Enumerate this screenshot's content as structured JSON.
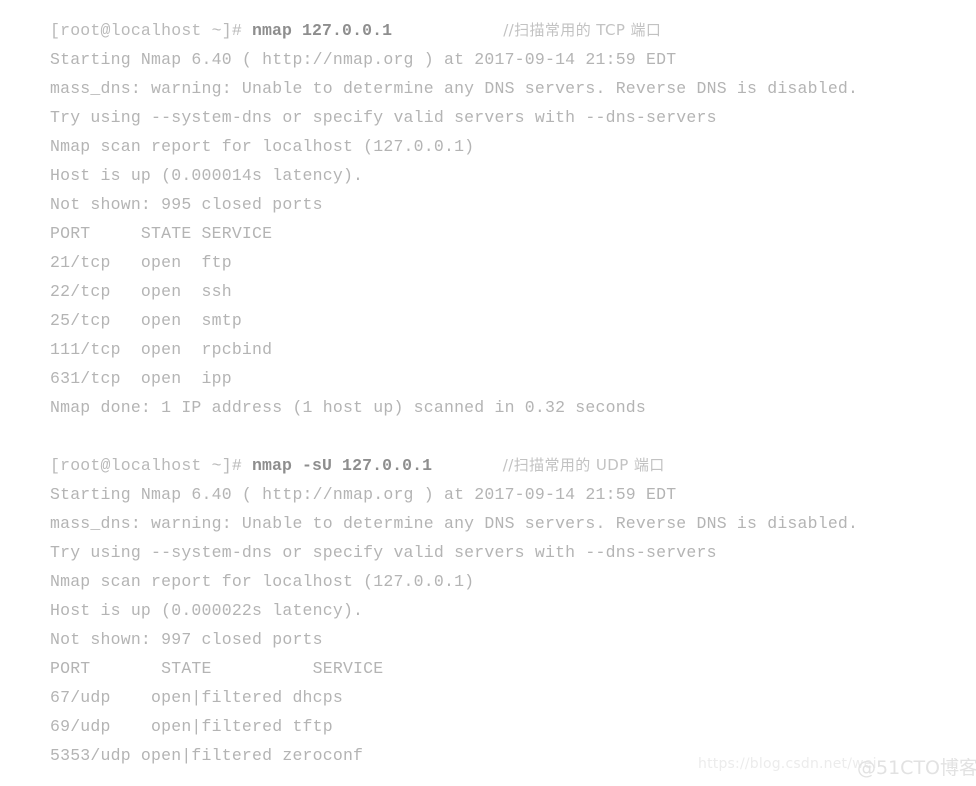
{
  "terminal": {
    "font_color": "#b4b4b4",
    "command_color": "#8e8e8e",
    "background": "#ffffff",
    "blocks": [
      {
        "name": "tcp-scan",
        "prompt": "[root@localhost ~]# ",
        "command": "nmap 127.0.0.1",
        "comment": "//扫描常用的 TCP 端口",
        "comment_ascii": "TCP",
        "output": [
          "Starting Nmap 6.40 ( http://nmap.org ) at 2017-09-14 21:59 EDT",
          "mass_dns: warning: Unable to determine any DNS servers. Reverse DNS is disabled.",
          "Try using --system-dns or specify valid servers with --dns-servers",
          "Nmap scan report for localhost (127.0.0.1)",
          "Host is up (0.000014s latency).",
          "Not shown: 995 closed ports",
          "PORT     STATE SERVICE",
          "21/tcp   open  ftp",
          "22/tcp   open  ssh",
          "25/tcp   open  smtp",
          "111/tcp  open  rpcbind",
          "631/tcp  open  ipp",
          "Nmap done: 1 IP address (1 host up) scanned in 0.32 seconds"
        ]
      },
      {
        "name": "udp-scan",
        "prompt": "[root@localhost ~]# ",
        "command": "nmap -sU 127.0.0.1",
        "comment": "//扫描常用的 UDP 端口",
        "comment_ascii": "UDP",
        "output": [
          "Starting Nmap 6.40 ( http://nmap.org ) at 2017-09-14 21:59 EDT",
          "mass_dns: warning: Unable to determine any DNS servers. Reverse DNS is disabled.",
          "Try using --system-dns or specify valid servers with --dns-servers",
          "Nmap scan report for localhost (127.0.0.1)",
          "Host is up (0.000022s latency).",
          "Not shown: 997 closed ports",
          "PORT       STATE          SERVICE",
          "67/udp    open|filtered dhcps",
          "69/udp    open|filtered tftp",
          "5353/udp open|filtered zeroconf"
        ]
      }
    ]
  },
  "watermarks": {
    "csdn": "https://blog.csdn.net/wei",
    "cto": "@51CTO博客"
  }
}
